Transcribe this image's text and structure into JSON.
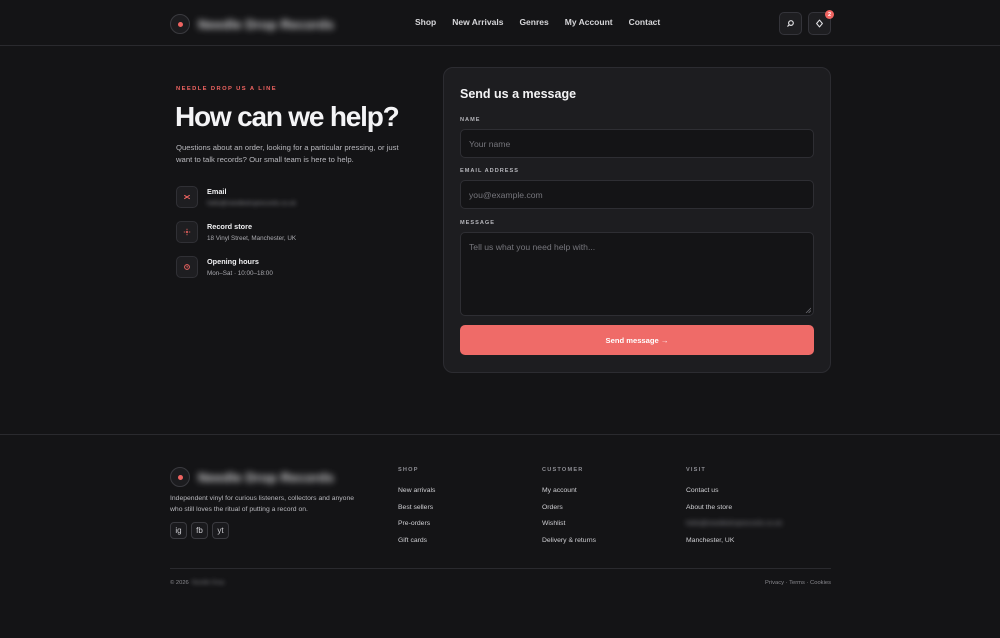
{
  "header": {
    "store_name": "Needle Drop Records",
    "nav": [
      "Shop",
      "New Arrivals",
      "Genres",
      "My Account",
      "Contact"
    ],
    "cart_count": "2",
    "search_icon": "search-icon",
    "cart_icon": "bag-icon"
  },
  "contact": {
    "eyebrow": "NEEDLE DROP US A LINE",
    "title": "How can we help?",
    "description": "Questions about an order, looking for a particular pressing, or just want to talk records? Our small team is here to help.",
    "items": [
      {
        "label": "Email",
        "value": "hello@needledroprecords.co.uk",
        "icon": "mail-icon"
      },
      {
        "label": "Record store",
        "value": "18 Vinyl Street, Manchester, UK",
        "icon": "location-icon"
      },
      {
        "label": "Opening hours",
        "value": "Mon–Sat · 10:00–18:00",
        "icon": "clock-icon"
      }
    ]
  },
  "form": {
    "title": "Send us a message",
    "name_label": "NAME",
    "name_placeholder": "Your name",
    "email_label": "EMAIL ADDRESS",
    "email_placeholder": "you@example.com",
    "message_label": "MESSAGE",
    "message_placeholder": "Tell us what you need help with...",
    "submit_label": "Send message →"
  },
  "footer": {
    "store_name": "Needle Drop Records",
    "description": "Independent vinyl for curious listeners, collectors and anyone who still loves the ritual of putting a record on.",
    "socials": [
      "ig",
      "fb",
      "yt"
    ],
    "columns": [
      {
        "heading": "SHOP",
        "links": [
          "New arrivals",
          "Best sellers",
          "Pre-orders",
          "Gift cards"
        ]
      },
      {
        "heading": "CUSTOMER",
        "links": [
          "My account",
          "Orders",
          "Wishlist",
          "Delivery & returns"
        ]
      },
      {
        "heading": "VISIT",
        "links": [
          "Contact us",
          "About the store",
          "hello@needledroprecords.co.uk",
          "Manchester, UK"
        ]
      }
    ],
    "copyright_prefix": "© 2026",
    "copyright_name": "Needle Drop",
    "legal": [
      "Privacy",
      "Terms",
      "Cookies"
    ],
    "legal_separator": "·"
  },
  "colors": {
    "accent": "#ef6461",
    "background": "#141416",
    "card": "#1d1d20"
  }
}
